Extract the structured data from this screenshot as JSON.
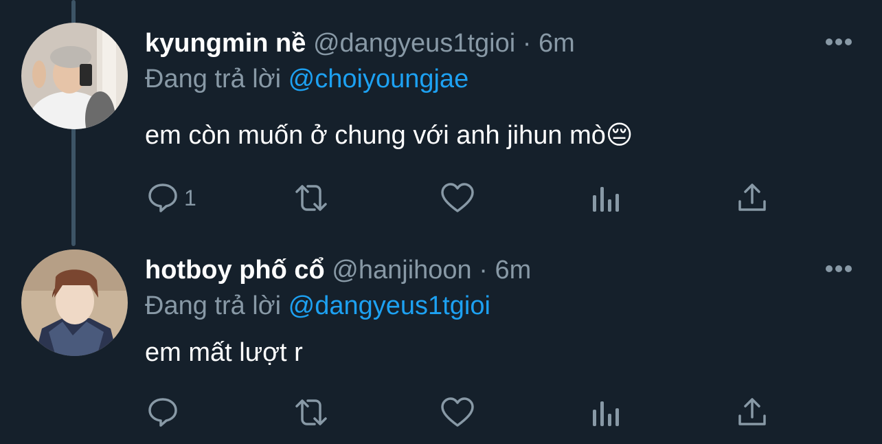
{
  "tweets": [
    {
      "display_name": "kyungmin nề",
      "handle": "@dangyeus1tgioi",
      "separator": "·",
      "time": "6m",
      "replying_prefix": "Đang trả lời",
      "replying_to": "@choiyoungjae",
      "text": "em còn muốn ở chung với anh jihun mò",
      "emoji": "😔",
      "reply_count": "1"
    },
    {
      "display_name": "hotboy phố cổ",
      "handle": "@hanjihoon",
      "separator": "·",
      "time": "6m",
      "replying_prefix": "Đang trả lời",
      "replying_to": "@dangyeus1tgioi",
      "text": "em mất lượt r",
      "emoji": "",
      "reply_count": ""
    }
  ],
  "icons": {
    "reply": "speech-bubble-icon",
    "retweet": "retweet-arrows-icon",
    "like": "heart-outline-icon",
    "analytics": "bar-chart-icon",
    "share": "share-upload-icon",
    "more": "three-dots-icon"
  },
  "colors": {
    "background": "#15202b",
    "thread_line": "#3d5466",
    "secondary_text": "#8899a6",
    "mention": "#1da1f2",
    "primary_text": "#ffffff"
  }
}
